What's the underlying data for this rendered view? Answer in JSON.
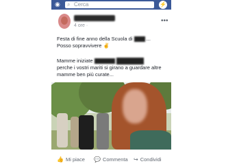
{
  "topbar": {
    "search_placeholder": "Cerca",
    "camera_icon": "camera-icon",
    "messenger_icon": "messenger-icon",
    "search_icon": "search-icon",
    "color": "#3b5998"
  },
  "post": {
    "time": "4 ore",
    "line1": "Festa di fine anno della Scuola di",
    "line1_tail": "...",
    "line2": "Posso sopravvivere ✌",
    "line3": "Mamme iniziate",
    "line4": "perche i vostri mariti si girano a guardare altre",
    "line5": "mamme ben più  curate..."
  },
  "actions": {
    "like": "Mi piace",
    "comment": "Commenta",
    "share": "Condividi"
  }
}
